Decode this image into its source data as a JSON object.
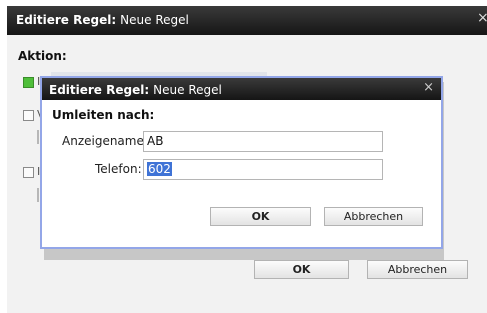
{
  "outer": {
    "title_bold": "Editiere Regel:",
    "title_name": "Neue Regel",
    "close": "×",
    "aktion_label": "Aktion:",
    "ghost_text": "",
    "ok_label": "OK",
    "cancel_label": "Abbrechen"
  },
  "inner": {
    "title_bold": "Editiere Regel:",
    "title_name": "Neue Regel",
    "close": "×",
    "section_label": "Umleiten nach:",
    "display_name_label": "Anzeigename:",
    "display_name_value": "AB",
    "phone_label": "Telefon:",
    "phone_value": "602",
    "ok_label": "OK",
    "cancel_label": "Abbrechen"
  },
  "colors": {
    "titlebar": "#161616",
    "selection": "#3f73d6",
    "modal_border": "#93a6e8",
    "checkbox_checked": "#4fbf3a"
  },
  "options": [
    {
      "checked": true,
      "text": "I"
    },
    {
      "checked": false,
      "text": "V"
    },
    {
      "checked": false,
      "text": "I"
    }
  ]
}
